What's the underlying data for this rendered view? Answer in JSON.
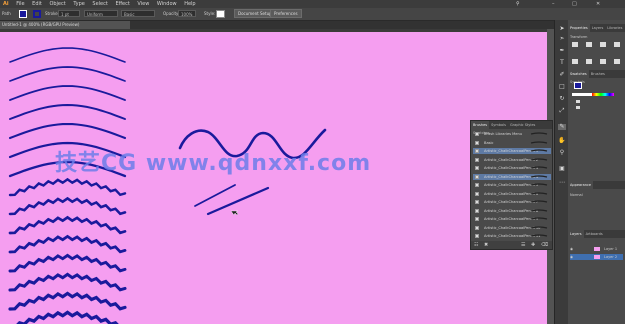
{
  "menubar": {
    "items": [
      "Ai",
      "File",
      "Edit",
      "Object",
      "Type",
      "Select",
      "Effect",
      "View",
      "Window",
      "Help"
    ]
  },
  "controlbar": {
    "selection_label": "Path",
    "stroke_label": "Stroke:",
    "stroke_value": "1 pt",
    "brush_label": "Uniform",
    "brush_value": "Basic",
    "opacity_label": "Opacity:",
    "opacity_value": "100%",
    "style_label": "Style:",
    "doc_setup_button": "Document Setup",
    "preferences_button": "Preferences"
  },
  "document_tab": {
    "title": "Untitled-1 @ 400% (RGB/GPU Preview)"
  },
  "watermark": {
    "text": "技艺CG  www.qdnxxf.com",
    "color": "#6d7eea"
  },
  "colors": {
    "artboard": "#f59ef0",
    "stroke": "#1a1a9c",
    "ui_dark": "#3b3b3b",
    "selection": "#5e7aa4"
  },
  "toolbar": {
    "tools": [
      "move-icon",
      "direct-select-icon",
      "pen-icon",
      "type-icon",
      "brush-icon",
      "rect-icon",
      "rotate-icon",
      "scale-icon",
      "eyedropper-icon",
      "hand-icon",
      "zoom-icon"
    ]
  },
  "right_panel": {
    "top_tabs": [
      "Properties",
      "Layers",
      "Libraries"
    ],
    "section_label": "Transform",
    "swatch_tabs": [
      "Swatches",
      "Brushes",
      "Symbols"
    ],
    "appearance_label": "Appearance",
    "stroke_dropdown": "Normal",
    "layers_tabs": [
      "Layers",
      "Artboards"
    ],
    "layers": [
      {
        "name": "Layer 1",
        "selected": false
      },
      {
        "name": "Layer 2",
        "selected": true
      }
    ]
  },
  "brushes_panel": {
    "tabs": [
      "Brushes",
      "Symbols",
      "Graphic Styles",
      "Swatches"
    ],
    "items": [
      {
        "label": "Brush Libraries Menu",
        "selected": false
      },
      {
        "label": "Basic",
        "selected": false
      },
      {
        "label": "Artistic_ChalkCharcoalPencil 1",
        "selected": true
      },
      {
        "label": "Artistic_ChalkCharcoalPencil 2",
        "selected": false
      },
      {
        "label": "Artistic_ChalkCharcoalPencil 3",
        "selected": false
      },
      {
        "label": "Artistic_ChalkCharcoalPencil 4",
        "selected": true
      },
      {
        "label": "Artistic_ChalkCharcoalPencil 5",
        "selected": false
      },
      {
        "label": "Artistic_ChalkCharcoalPencil 6",
        "selected": false
      },
      {
        "label": "Artistic_ChalkCharcoalPencil 7",
        "selected": false
      },
      {
        "label": "Artistic_ChalkCharcoalPencil 8",
        "selected": false
      },
      {
        "label": "Artistic_ChalkCharcoalPencil 9",
        "selected": false
      },
      {
        "label": "Artistic_ChalkCharcoalPencil 10",
        "selected": false
      },
      {
        "label": "Artistic_ChalkCharcoalPencil 11",
        "selected": false
      },
      {
        "label": "Artistic_ChalkCharcoalPencil 12",
        "selected": false
      }
    ],
    "footer_icons": [
      "library-icon",
      "remove-stroke-icon",
      "options-icon",
      "new-brush-icon",
      "delete-icon"
    ]
  }
}
